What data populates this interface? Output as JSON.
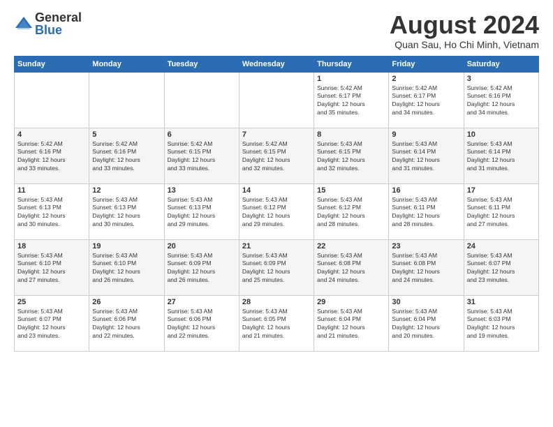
{
  "logo": {
    "general": "General",
    "blue": "Blue"
  },
  "header": {
    "month_year": "August 2024",
    "location": "Quan Sau, Ho Chi Minh, Vietnam"
  },
  "weekdays": [
    "Sunday",
    "Monday",
    "Tuesday",
    "Wednesday",
    "Thursday",
    "Friday",
    "Saturday"
  ],
  "weeks": [
    [
      {
        "day": "",
        "info": ""
      },
      {
        "day": "",
        "info": ""
      },
      {
        "day": "",
        "info": ""
      },
      {
        "day": "",
        "info": ""
      },
      {
        "day": "1",
        "info": "Sunrise: 5:42 AM\nSunset: 6:17 PM\nDaylight: 12 hours\nand 35 minutes."
      },
      {
        "day": "2",
        "info": "Sunrise: 5:42 AM\nSunset: 6:17 PM\nDaylight: 12 hours\nand 34 minutes."
      },
      {
        "day": "3",
        "info": "Sunrise: 5:42 AM\nSunset: 6:16 PM\nDaylight: 12 hours\nand 34 minutes."
      }
    ],
    [
      {
        "day": "4",
        "info": "Sunrise: 5:42 AM\nSunset: 6:16 PM\nDaylight: 12 hours\nand 33 minutes."
      },
      {
        "day": "5",
        "info": "Sunrise: 5:42 AM\nSunset: 6:16 PM\nDaylight: 12 hours\nand 33 minutes."
      },
      {
        "day": "6",
        "info": "Sunrise: 5:42 AM\nSunset: 6:15 PM\nDaylight: 12 hours\nand 33 minutes."
      },
      {
        "day": "7",
        "info": "Sunrise: 5:42 AM\nSunset: 6:15 PM\nDaylight: 12 hours\nand 32 minutes."
      },
      {
        "day": "8",
        "info": "Sunrise: 5:43 AM\nSunset: 6:15 PM\nDaylight: 12 hours\nand 32 minutes."
      },
      {
        "day": "9",
        "info": "Sunrise: 5:43 AM\nSunset: 6:14 PM\nDaylight: 12 hours\nand 31 minutes."
      },
      {
        "day": "10",
        "info": "Sunrise: 5:43 AM\nSunset: 6:14 PM\nDaylight: 12 hours\nand 31 minutes."
      }
    ],
    [
      {
        "day": "11",
        "info": "Sunrise: 5:43 AM\nSunset: 6:13 PM\nDaylight: 12 hours\nand 30 minutes."
      },
      {
        "day": "12",
        "info": "Sunrise: 5:43 AM\nSunset: 6:13 PM\nDaylight: 12 hours\nand 30 minutes."
      },
      {
        "day": "13",
        "info": "Sunrise: 5:43 AM\nSunset: 6:13 PM\nDaylight: 12 hours\nand 29 minutes."
      },
      {
        "day": "14",
        "info": "Sunrise: 5:43 AM\nSunset: 6:12 PM\nDaylight: 12 hours\nand 29 minutes."
      },
      {
        "day": "15",
        "info": "Sunrise: 5:43 AM\nSunset: 6:12 PM\nDaylight: 12 hours\nand 28 minutes."
      },
      {
        "day": "16",
        "info": "Sunrise: 5:43 AM\nSunset: 6:11 PM\nDaylight: 12 hours\nand 28 minutes."
      },
      {
        "day": "17",
        "info": "Sunrise: 5:43 AM\nSunset: 6:11 PM\nDaylight: 12 hours\nand 27 minutes."
      }
    ],
    [
      {
        "day": "18",
        "info": "Sunrise: 5:43 AM\nSunset: 6:10 PM\nDaylight: 12 hours\nand 27 minutes."
      },
      {
        "day": "19",
        "info": "Sunrise: 5:43 AM\nSunset: 6:10 PM\nDaylight: 12 hours\nand 26 minutes."
      },
      {
        "day": "20",
        "info": "Sunrise: 5:43 AM\nSunset: 6:09 PM\nDaylight: 12 hours\nand 26 minutes."
      },
      {
        "day": "21",
        "info": "Sunrise: 5:43 AM\nSunset: 6:09 PM\nDaylight: 12 hours\nand 25 minutes."
      },
      {
        "day": "22",
        "info": "Sunrise: 5:43 AM\nSunset: 6:08 PM\nDaylight: 12 hours\nand 24 minutes."
      },
      {
        "day": "23",
        "info": "Sunrise: 5:43 AM\nSunset: 6:08 PM\nDaylight: 12 hours\nand 24 minutes."
      },
      {
        "day": "24",
        "info": "Sunrise: 5:43 AM\nSunset: 6:07 PM\nDaylight: 12 hours\nand 23 minutes."
      }
    ],
    [
      {
        "day": "25",
        "info": "Sunrise: 5:43 AM\nSunset: 6:07 PM\nDaylight: 12 hours\nand 23 minutes."
      },
      {
        "day": "26",
        "info": "Sunrise: 5:43 AM\nSunset: 6:06 PM\nDaylight: 12 hours\nand 22 minutes."
      },
      {
        "day": "27",
        "info": "Sunrise: 5:43 AM\nSunset: 6:06 PM\nDaylight: 12 hours\nand 22 minutes."
      },
      {
        "day": "28",
        "info": "Sunrise: 5:43 AM\nSunset: 6:05 PM\nDaylight: 12 hours\nand 21 minutes."
      },
      {
        "day": "29",
        "info": "Sunrise: 5:43 AM\nSunset: 6:04 PM\nDaylight: 12 hours\nand 21 minutes."
      },
      {
        "day": "30",
        "info": "Sunrise: 5:43 AM\nSunset: 6:04 PM\nDaylight: 12 hours\nand 20 minutes."
      },
      {
        "day": "31",
        "info": "Sunrise: 5:43 AM\nSunset: 6:03 PM\nDaylight: 12 hours\nand 19 minutes."
      }
    ]
  ]
}
